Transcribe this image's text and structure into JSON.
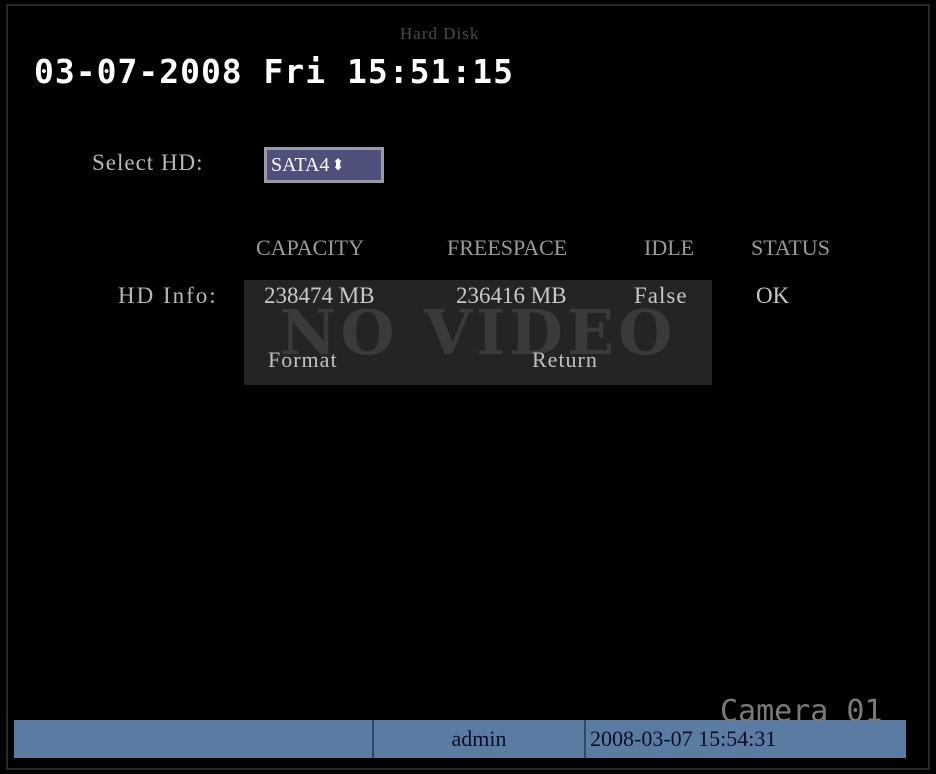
{
  "osd": {
    "datetime": "03-07-2008 Fri 15:51:15",
    "camera": "Camera 01"
  },
  "menu": {
    "title": "Hard Disk",
    "select_hd_label": "Select HD:",
    "select_hd_value": "SATA4",
    "select_arrows": "⬍"
  },
  "hd_table": {
    "columns": [
      "CAPACITY",
      "FREESPACE",
      "IDLE",
      "STATUS"
    ],
    "row_label": "HD Info:",
    "row": {
      "capacity": "238474 MB",
      "freespace": "236416 MB",
      "idle": "False",
      "status": "OK"
    }
  },
  "buttons": {
    "format": "Format",
    "return": "Return"
  },
  "background": {
    "no_video": "NO VIDEO"
  },
  "status_bar": {
    "cell1": "",
    "user": "admin",
    "datetime": "2008-03-07 15:54:31"
  },
  "colors": {
    "background": "#000000",
    "select_bg": "#4f4f7c",
    "status_bar": "#5b7ca2"
  }
}
